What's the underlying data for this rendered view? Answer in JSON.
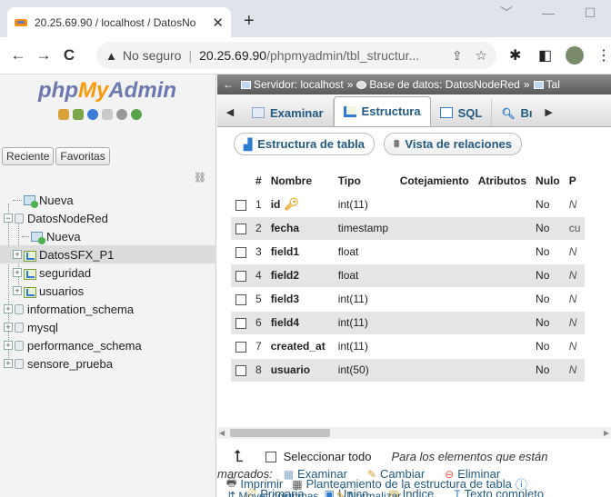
{
  "browser": {
    "tab_title": "20.25.69.90 / localhost / DatosNo",
    "tab_close": "✕",
    "new_tab": "+",
    "nav": {
      "back": "←",
      "forward": "→",
      "reload": "C"
    },
    "address": {
      "security_warning": "No seguro",
      "url_host": "20.25.69.90",
      "url_path": "/phpmyadmin/tbl_structur..."
    },
    "window": {
      "minimize": "﹀",
      "restore": "—",
      "maximize": "☐",
      "close": "✕"
    }
  },
  "sidebar": {
    "logo_php": "php",
    "logo_my": "My",
    "logo_admin": "Admin",
    "tabs": [
      "Reciente",
      "Favoritas"
    ],
    "tree": [
      {
        "label": "Nueva",
        "level": 0,
        "kind": "new"
      },
      {
        "label": "DatosNodeRed",
        "level": 0,
        "kind": "db",
        "expander": "−"
      },
      {
        "label": "Nueva",
        "level": 1,
        "kind": "new"
      },
      {
        "label": "DatosSFX_P1",
        "level": 1,
        "kind": "table",
        "expander": "+",
        "selected": true
      },
      {
        "label": "seguridad",
        "level": 1,
        "kind": "table",
        "expander": "+"
      },
      {
        "label": "usuarios",
        "level": 1,
        "kind": "table",
        "expander": "+"
      },
      {
        "label": "information_schema",
        "level": 0,
        "kind": "db",
        "expander": "+"
      },
      {
        "label": "mysql",
        "level": 0,
        "kind": "db",
        "expander": "+"
      },
      {
        "label": "performance_schema",
        "level": 0,
        "kind": "db",
        "expander": "+"
      },
      {
        "label": "sensore_prueba",
        "level": 0,
        "kind": "db",
        "expander": "+"
      }
    ]
  },
  "main": {
    "breadcrumb": {
      "server": "Servidor: localhost",
      "database": "Base de datos: DatosNodeRed",
      "table": "Tal"
    },
    "tabs": [
      {
        "label": "Examinar",
        "active": false
      },
      {
        "label": "Estructura",
        "active": true
      },
      {
        "label": "SQL",
        "active": false
      },
      {
        "label": "Bı",
        "active": false
      }
    ],
    "subtabs": [
      {
        "label": "Estructura de tabla",
        "active": true
      },
      {
        "label": "Vista de relaciones",
        "active": false
      }
    ],
    "table": {
      "headers": [
        "#",
        "Nombre",
        "Tipo",
        "Cotejamiento",
        "Atributos",
        "Nulo",
        "P"
      ],
      "rows": [
        {
          "num": "1",
          "name": "id",
          "type": "int(11)",
          "nulo": "No",
          "pred": "N",
          "primary": true
        },
        {
          "num": "2",
          "name": "fecha",
          "type": "timestamp",
          "nulo": "No",
          "pred": "cu"
        },
        {
          "num": "3",
          "name": "field1",
          "type": "float",
          "nulo": "No",
          "pred": "N"
        },
        {
          "num": "4",
          "name": "field2",
          "type": "float",
          "nulo": "No",
          "pred": "N"
        },
        {
          "num": "5",
          "name": "field3",
          "type": "int(11)",
          "nulo": "No",
          "pred": "N"
        },
        {
          "num": "6",
          "name": "field4",
          "type": "int(11)",
          "nulo": "No",
          "pred": "N"
        },
        {
          "num": "7",
          "name": "created_at",
          "type": "int(11)",
          "nulo": "No",
          "pred": "N"
        },
        {
          "num": "8",
          "name": "usuario",
          "type": "int(50)",
          "nulo": "No",
          "pred": "N"
        }
      ]
    },
    "bulk": {
      "select_all": "Seleccionar todo",
      "for_selected": "Para los elementos que están",
      "marked": "marcados:",
      "browse": "Examinar",
      "change": "Cambiar",
      "drop": "Eliminar",
      "primary": "Primaria",
      "unique": "Único",
      "index": "Índice",
      "fulltext": "Texto completo"
    },
    "footer": {
      "print": "Imprimir",
      "propose": "Planteamiento de la estructura de tabla",
      "move": "Mover columnas",
      "normalize": "Normalizar"
    }
  }
}
